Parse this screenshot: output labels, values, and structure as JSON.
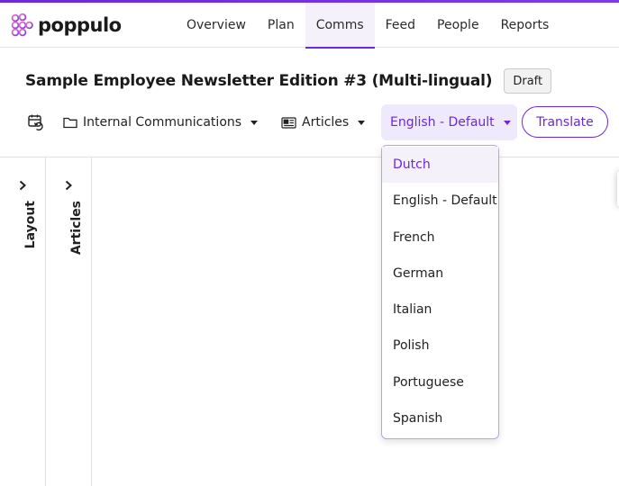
{
  "app": {
    "brand": "poppulo",
    "accent_color": "#6d28d9"
  },
  "nav": {
    "items": [
      {
        "label": "Overview"
      },
      {
        "label": "Plan"
      },
      {
        "label": "Comms",
        "active": true
      },
      {
        "label": "Feed"
      },
      {
        "label": "People"
      },
      {
        "label": "Reports"
      }
    ]
  },
  "page": {
    "title": "Sample Employee Newsletter Edition #3 (Multi-lingual)",
    "status_badge": "Draft"
  },
  "toolbar": {
    "history_icon": "calendar-history-icon",
    "channel_label": "Internal Communications",
    "channel_icon": "folder-icon",
    "content_label": "Articles",
    "content_icon": "newspaper-icon",
    "language_label": "English - Default",
    "translate_label": "Translate"
  },
  "side_panels": {
    "layout_label": "Layout",
    "articles_label": "Articles"
  },
  "language_dropdown": {
    "highlighted": "Dutch",
    "options": [
      "Dutch",
      "English - Default",
      "French",
      "German",
      "Italian",
      "Polish",
      "Portuguese",
      "Spanish"
    ]
  }
}
